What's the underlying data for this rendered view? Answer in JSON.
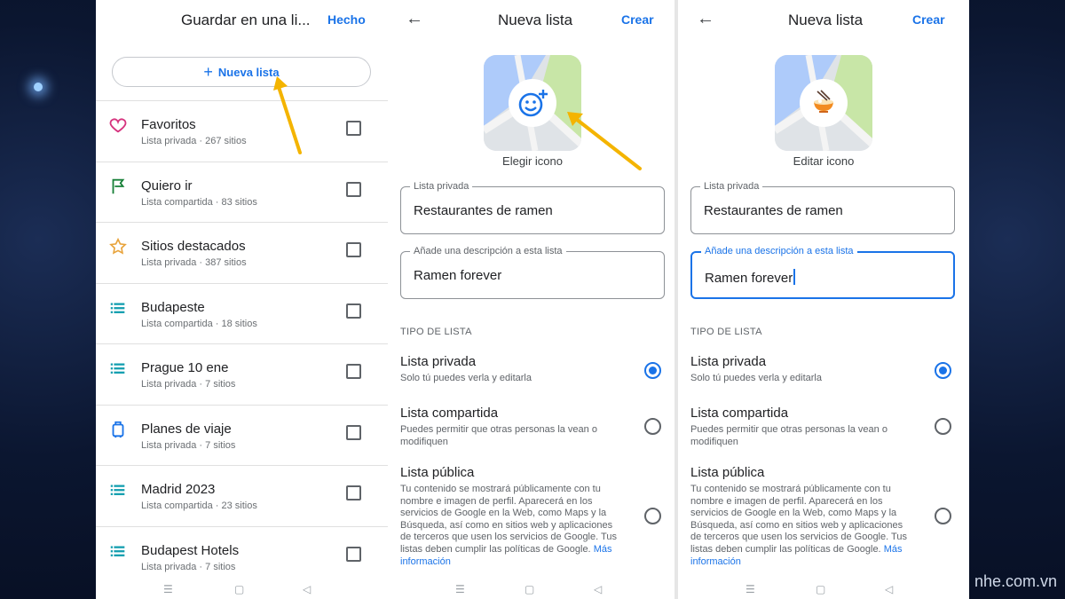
{
  "colors": {
    "accent": "#1a73e8",
    "arrow": "#f4b400",
    "heart": "#d6337e",
    "flag": "#188038",
    "star": "#e8a33b",
    "list": "#129eaf",
    "luggage": "#1a73e8"
  },
  "watermark": "nhe.com.vn",
  "panel1": {
    "title": "Guardar en una li...",
    "done": "Hecho",
    "new_list": "Nueva lista",
    "lists": [
      {
        "icon": "heart-icon",
        "name": "Favoritos",
        "sub": "Lista privada · 267 sitios"
      },
      {
        "icon": "flag-icon",
        "name": "Quiero ir",
        "sub": "Lista compartida · 83 sitios"
      },
      {
        "icon": "star-icon",
        "name": "Sitios destacados",
        "sub": "Lista privada · 387 sitios"
      },
      {
        "icon": "list-icon",
        "name": "Budapeste",
        "sub": "Lista compartida · 18 sitios"
      },
      {
        "icon": "list-icon",
        "name": "Prague 10 ene",
        "sub": "Lista privada · 7 sitios"
      },
      {
        "icon": "luggage-icon",
        "name": "Planes de viaje",
        "sub": "Lista privada · 7 sitios"
      },
      {
        "icon": "list-icon",
        "name": "Madrid 2023",
        "sub": "Lista compartida · 23 sitios"
      },
      {
        "icon": "list-icon",
        "name": "Budapest Hotels",
        "sub": "Lista privada · 7 sitios"
      }
    ]
  },
  "panel2": {
    "title": "Nueva lista",
    "create": "Crear",
    "icon_caption": "Elegir icono",
    "name_label": "Lista privada",
    "name_value": "Restaurantes de ramen",
    "desc_label": "Añade una descripción a esta lista",
    "desc_value": "Ramen forever"
  },
  "panel3": {
    "title": "Nueva lista",
    "create": "Crear",
    "icon_caption": "Editar icono",
    "name_label": "Lista privada",
    "name_value": "Restaurantes de ramen",
    "desc_label": "Añade una descripción a esta lista",
    "desc_value": "Ramen forever"
  },
  "list_type": {
    "section": "TIPO DE LISTA",
    "selected": "private",
    "private_title": "Lista privada",
    "private_desc": "Solo tú puedes verla y editarla",
    "shared_title": "Lista compartida",
    "shared_desc": "Puedes permitir que otras personas la vean o modifiquen",
    "public_title": "Lista pública",
    "public_desc": "Tu contenido se mostrará públicamente con tu nombre e imagen de perfil. Aparecerá en los servicios de Google en la Web, como Maps y la Búsqueda, así como en sitios web y aplicaciones de terceros que usen los servicios de Google. Tus listas deben cumplir las políticas de Google.",
    "more_info": "Más información"
  }
}
